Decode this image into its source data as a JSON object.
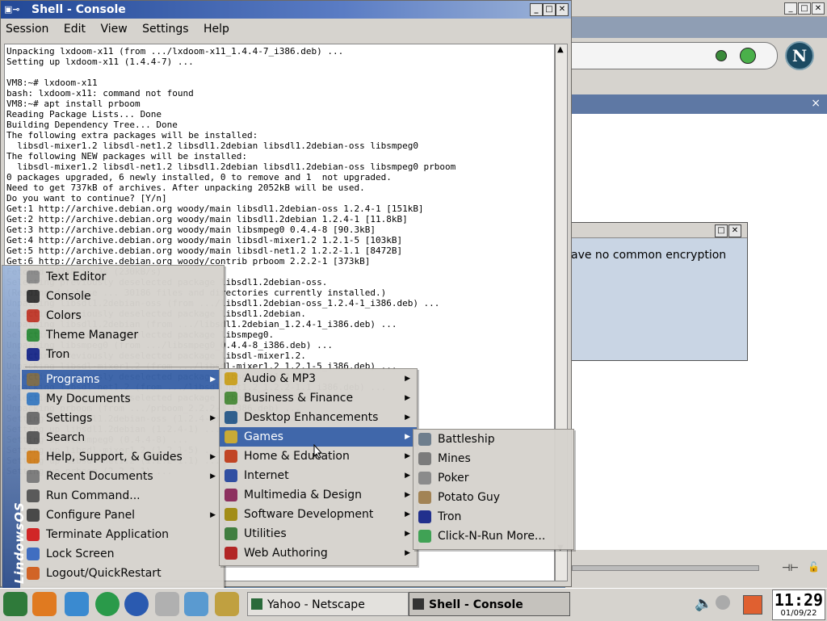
{
  "netscape": {
    "side_close": "×",
    "dialog_message": "ave no common encryption",
    "logo_letter": "N"
  },
  "console": {
    "title": "Shell - Console",
    "menu": [
      "Session",
      "Edit",
      "View",
      "Settings",
      "Help"
    ],
    "terminal_text": "Unpacking lxdoom-x11 (from .../lxdoom-x11_1.4.4-7_i386.deb) ...\nSetting up lxdoom-x11 (1.4.4-7) ...\n\nVM8:~# lxdoom-x11\nbash: lxdoom-x11: command not found\nVM8:~# apt install prboom\nReading Package Lists... Done\nBuilding Dependency Tree... Done\nThe following extra packages will be installed:\n  libsdl-mixer1.2 libsdl-net1.2 libsdl1.2debian libsdl1.2debian-oss libsmpeg0\nThe following NEW packages will be installed:\n  libsdl-mixer1.2 libsdl-net1.2 libsdl1.2debian libsdl1.2debian-oss libsmpeg0 prboom\n0 packages upgraded, 6 newly installed, 0 to remove and 1  not upgraded.\nNeed to get 737kB of archives. After unpacking 2052kB will be used.\nDo you want to continue? [Y/n]\nGet:1 http://archive.debian.org woody/main libsdl1.2debian-oss 1.2.4-1 [151kB]\nGet:2 http://archive.debian.org woody/main libsdl1.2debian 1.2.4-1 [11.8kB]\nGet:3 http://archive.debian.org woody/main libsmpeg0 0.4.4-8 [90.3kB]\nGet:4 http://archive.debian.org woody/main libsdl-mixer1.2 1.2.1-5 [103kB]\nGet:5 http://archive.debian.org woody/main libsdl-net1.2 1.2.2-1.1 [8472B]\nGet:6 http://archive.debian.org woody/contrib prboom 2.2.2-1 [373kB]\nFetched 737kB in 3s (230kB/s)\nSelecting previously deselected package libsdl1.2debian-oss.\n(Reading database ... 30186 files and directories currently installed.)\nUnpacking libsdl1.2debian-oss (from .../libsdl1.2debian-oss_1.2.4-1_i386.deb) ...\nSelecting previously deselected package libsdl1.2debian.\nUnpacking libsdl1.2debian (from .../libsdl1.2debian_1.2.4-1_i386.deb) ...\nSelecting previously deselected package libsmpeg0.\nUnpacking libsmpeg0 (from .../libsmpeg0_0.4.4-8_i386.deb) ...\nSelecting previously deselected package libsdl-mixer1.2.\nUnpacking libsdl-mixer1.2 (from .../libsdl-mixer1.2_1.2.1-5_i386.deb) ...\nSelecting previously deselected package libsdl-net1.2.\nUnpacking libsdl-net1.2 (from .../libsdl-net1.2_1.2.2-1.1_i386.deb) ...\nSelecting previously deselected package prboom.\nUnpacking prboom (from .../prboom_2.2.2-1_i386.deb) ...\nSetting up libsdl1.2debian-oss (1.2.4-1) ...\nSetting up libsdl1.2debian (1.2.4-1) ...\nSetting up libsmpeg0 (0.4.4-8) ...\nSetting up libsdl-mixer1.2 (1.2.1-5) ...\nSetting up libsdl-net1.2 (1.2.2-1.1) ...\nSetting up prboom (2.2.2-1) ..."
  },
  "start_menu": {
    "brand": "LindowsOS",
    "recent": [
      {
        "label": "Text Editor",
        "icon": "text-editor-icon",
        "color": "#8a8a8a"
      },
      {
        "label": "Console",
        "icon": "console-icon",
        "color": "#333333"
      },
      {
        "label": "Colors",
        "icon": "colors-icon",
        "color": "#c0392b"
      },
      {
        "label": "Theme Manager",
        "icon": "theme-manager-icon",
        "color": "#2e8b3a"
      },
      {
        "label": "Tron",
        "icon": "tron-icon",
        "color": "#1a2a8a"
      }
    ],
    "main": [
      {
        "label": "Programs",
        "icon": "programs-icon",
        "color": "#7a6a4a",
        "arrow": true,
        "selected": true
      },
      {
        "label": "My Documents",
        "icon": "documents-icon",
        "color": "#3a7ac0",
        "arrow": false
      },
      {
        "label": "Settings",
        "icon": "settings-icon",
        "color": "#6a6a6a",
        "arrow": true
      },
      {
        "label": "Search",
        "icon": "search-icon",
        "color": "#555555",
        "arrow": false
      },
      {
        "label": "Help, Support, & Guides",
        "icon": "help-icon",
        "color": "#d08020",
        "arrow": true
      },
      {
        "label": "Recent Documents",
        "icon": "recent-documents-icon",
        "color": "#7a7a7a",
        "arrow": true
      },
      {
        "label": "Run Command...",
        "icon": "run-command-icon",
        "color": "#555555",
        "arrow": false
      },
      {
        "label": "Configure Panel",
        "icon": "configure-panel-icon",
        "color": "#444444",
        "arrow": true
      },
      {
        "label": "Terminate Application",
        "icon": "terminate-icon",
        "color": "#d02020",
        "arrow": false
      },
      {
        "label": "Lock Screen",
        "icon": "lock-icon",
        "color": "#3a6ac0",
        "arrow": false
      },
      {
        "label": "Logout/QuickRestart",
        "icon": "logout-icon",
        "color": "#d06020",
        "arrow": false
      }
    ]
  },
  "programs_menu": [
    {
      "label": "Audio & MP3",
      "icon": "audio-icon",
      "color": "#c9a020"
    },
    {
      "label": "Business & Finance",
      "icon": "business-icon",
      "color": "#4a8a3a"
    },
    {
      "label": "Desktop Enhancements",
      "icon": "desktop-icon",
      "color": "#2a5a8a"
    },
    {
      "label": "Games",
      "icon": "games-icon",
      "color": "#c8a830",
      "selected": true
    },
    {
      "label": "Home & Education",
      "icon": "home-icon",
      "color": "#c04020"
    },
    {
      "label": "Internet",
      "icon": "internet-icon",
      "color": "#2a4aa0"
    },
    {
      "label": "Multimedia & Design",
      "icon": "multimedia-icon",
      "color": "#8a2a5a"
    },
    {
      "label": "Software Development",
      "icon": "software-icon",
      "color": "#a08a10"
    },
    {
      "label": "Utilities",
      "icon": "utilities-icon",
      "color": "#3a7a3a"
    },
    {
      "label": "Web Authoring",
      "icon": "web-authoring-icon",
      "color": "#b02020"
    }
  ],
  "games_menu": [
    {
      "label": "Battleship",
      "icon": "battleship-icon",
      "color": "#6a7a8a"
    },
    {
      "label": "Mines",
      "icon": "mines-icon",
      "color": "#777777"
    },
    {
      "label": "Poker",
      "icon": "poker-icon",
      "color": "#888888"
    },
    {
      "label": "Potato Guy",
      "icon": "potato-guy-icon",
      "color": "#a08050"
    },
    {
      "label": "Tron",
      "icon": "tron-icon",
      "color": "#1a2a8a"
    },
    {
      "label": "Click-N-Run More...",
      "icon": "click-n-run-icon",
      "color": "#3aa050"
    }
  ],
  "taskbar": {
    "tasks": [
      {
        "label": "Yahoo - Netscape",
        "active": false,
        "icon": "netscape-icon"
      },
      {
        "label": "Shell - Console",
        "active": true,
        "icon": "console-icon"
      }
    ],
    "clock_time": "11:29",
    "clock_date": "01/09/22"
  }
}
